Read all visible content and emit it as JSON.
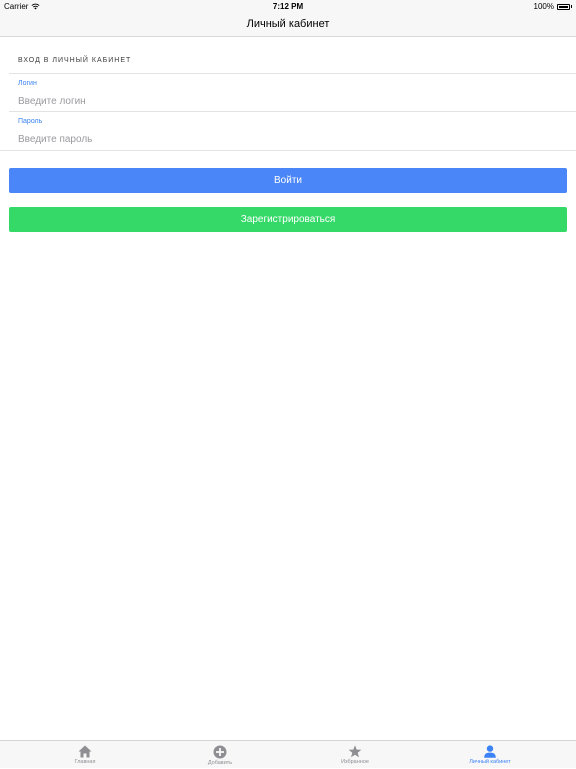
{
  "status_bar": {
    "carrier": "Carrier",
    "time": "7:12 PM",
    "battery": "100%"
  },
  "nav": {
    "title": "Личный кабинет"
  },
  "login_section": {
    "header": "ВХОД В ЛИЧНЫЙ КАБИНЕТ",
    "login_label": "Логин",
    "login_placeholder": "Введите логин",
    "login_value": "",
    "password_label": "Пароль",
    "password_placeholder": "Введите пароль",
    "password_value": ""
  },
  "buttons": {
    "login": "Войти",
    "register": "Зарегистрироваться"
  },
  "colors": {
    "accent": "#4a86f7",
    "register": "#35d968",
    "label_blue": "#3b82f6",
    "inactive": "#8e8e93"
  },
  "tabs": [
    {
      "label": "Главная",
      "icon": "home-icon",
      "active": false
    },
    {
      "label": "Добавить",
      "icon": "add-circle-icon",
      "active": false
    },
    {
      "label": "Избранное",
      "icon": "star-icon",
      "active": false
    },
    {
      "label": "Личный кабинет",
      "icon": "person-icon",
      "active": true
    }
  ]
}
